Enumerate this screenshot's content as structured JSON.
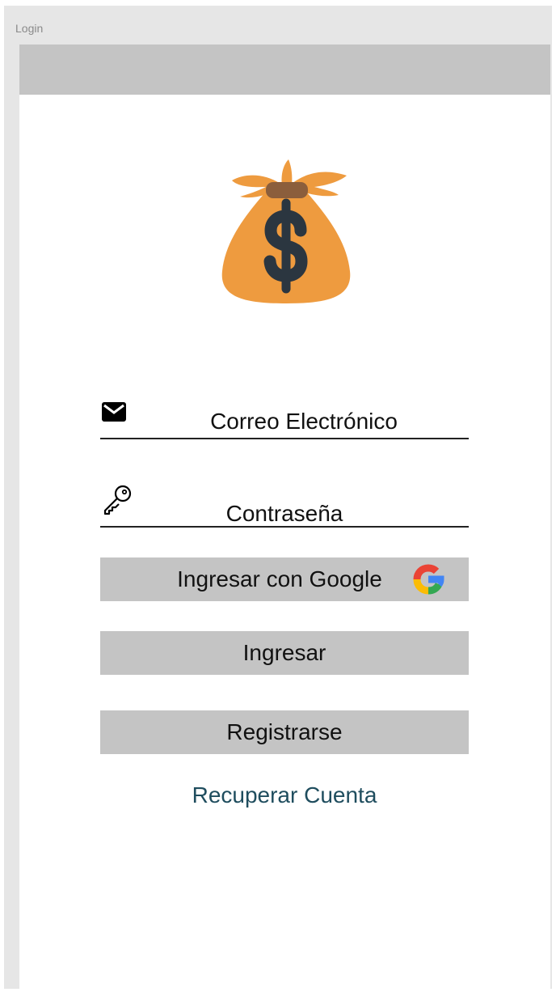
{
  "window": {
    "title": "Login"
  },
  "logo": {
    "icon": "money-bag-icon",
    "bag_color": "#EE9B3F",
    "knot_color": "#8B5E3C",
    "symbol_color": "#2B3640"
  },
  "form": {
    "email_placeholder": "Correo Electrónico",
    "email_icon": "envelope-icon",
    "password_placeholder": "Contraseña",
    "password_icon": "key-icon"
  },
  "buttons": {
    "google_label": "Ingresar con Google",
    "google_icon": "google-icon",
    "login_label": "Ingresar",
    "register_label": "Registrarse"
  },
  "links": {
    "recover_label": "Recuperar Cuenta"
  },
  "colors": {
    "button_bg": "#C4C4C4",
    "link": "#1F4D5E",
    "frame_bg": "#E6E6E6"
  }
}
